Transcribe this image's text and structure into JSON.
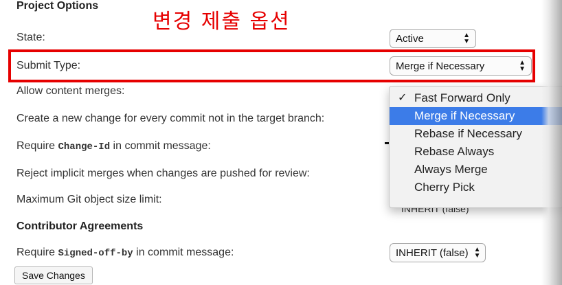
{
  "overlay_title": "변경 제출 옵션",
  "project_options": {
    "title": "Project Options",
    "state": {
      "label": "State:",
      "value": "Active"
    },
    "submit_type": {
      "label": "Submit Type:",
      "value": "Merge if Necessary"
    },
    "allow_content_merges": {
      "label": "Allow content merges:"
    },
    "create_new_change": {
      "label": "Create a new change for every commit not in the target branch:"
    },
    "require_change_id": {
      "prefix": "Require ",
      "code": "Change-Id",
      "suffix": " in commit message:"
    },
    "reject_implicit": {
      "label": "Reject implicit merges when changes are pushed for review:"
    },
    "max_object_size": {
      "label": "Maximum Git object size limit:"
    },
    "peek_text": "INHERIT (false)"
  },
  "dropdown": {
    "items": [
      {
        "label": "Fast Forward Only",
        "checked": true,
        "selected": false
      },
      {
        "label": "Merge if Necessary",
        "checked": false,
        "selected": true
      },
      {
        "label": "Rebase if Necessary",
        "checked": false,
        "selected": false
      },
      {
        "label": "Rebase Always",
        "checked": false,
        "selected": false
      },
      {
        "label": "Always Merge",
        "checked": false,
        "selected": false
      },
      {
        "label": "Cherry Pick",
        "checked": false,
        "selected": false
      }
    ],
    "check_glyph": "✓"
  },
  "contributor_agreements": {
    "title": "Contributor Agreements",
    "require_signed_off": {
      "prefix": "Require ",
      "code": "Signed-off-by",
      "suffix": " in commit message:",
      "value": "INHERIT (false)"
    }
  },
  "save_button": {
    "label": "Save Changes"
  },
  "colors": {
    "annotation": "#e60000",
    "selection": "#3c7ce8"
  }
}
